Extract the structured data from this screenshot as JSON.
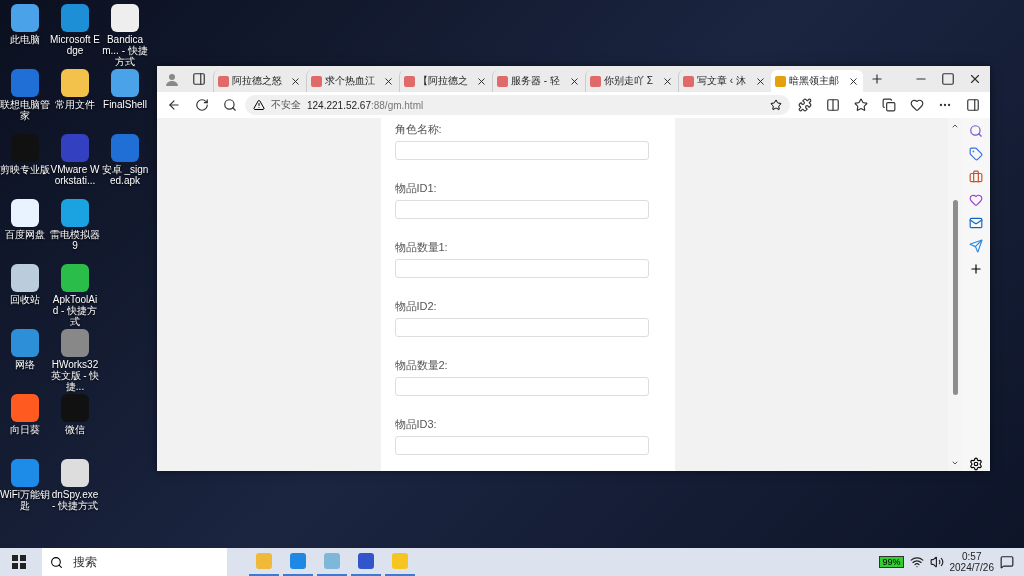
{
  "desktop_icons": [
    {
      "label": "此电脑"
    },
    {
      "label": "联想电脑管家"
    },
    {
      "label": "剪映专业版"
    },
    {
      "label": "百度网盘"
    },
    {
      "label": "回收站"
    },
    {
      "label": "网络"
    },
    {
      "label": "向日葵"
    },
    {
      "label": "WiFi万能钥匙"
    },
    {
      "label": "Microsoft Edge"
    },
    {
      "label": "常用文件"
    },
    {
      "label": "VMware Workstati..."
    },
    {
      "label": "雷电模拟器9"
    },
    {
      "label": "ApkToolAid - 快捷方式"
    },
    {
      "label": "HWorks32英文版 - 快捷..."
    },
    {
      "label": "微信"
    },
    {
      "label": "dnSpy.exe - 快捷方式"
    },
    {
      "label": "Bandicam... - 快捷方式"
    },
    {
      "label": "FinalShell"
    },
    {
      "label": "安卓 _signed.apk"
    }
  ],
  "browser": {
    "tabs": [
      {
        "title": "阿拉德之怒",
        "selected": false
      },
      {
        "title": "求个热血江",
        "selected": false
      },
      {
        "title": "【阿拉德之",
        "selected": false
      },
      {
        "title": "服务器 - 轻",
        "selected": false
      },
      {
        "title": "你别走吖 Σ",
        "selected": false
      },
      {
        "title": "写文章 ‹ 沐",
        "selected": false
      },
      {
        "title": "暗黑领主邮",
        "selected": true
      }
    ],
    "security": "不安全",
    "url_host": "124.221.52.67",
    "url_path": ":88/gm.html"
  },
  "form": {
    "fields": [
      {
        "label": "角色名称:"
      },
      {
        "label": "物品ID1:"
      },
      {
        "label": "物品数量1:"
      },
      {
        "label": "物品ID2:"
      },
      {
        "label": "物品数量2:"
      },
      {
        "label": "物品ID3:"
      }
    ]
  },
  "taskbar": {
    "search": {
      "placeholder": "搜索"
    },
    "battery": "99%",
    "time": "0:57",
    "date": "2024/7/26"
  }
}
